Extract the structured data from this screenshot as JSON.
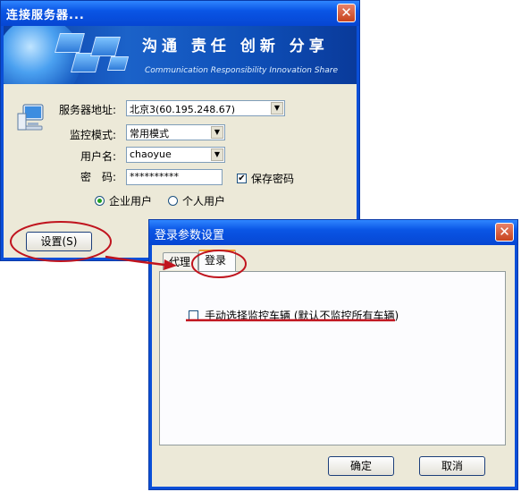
{
  "connect_dialog": {
    "title": "连接服务器...",
    "close_glyph": "✕",
    "banner": {
      "slogan": "沟通 责任 创新 分享",
      "slogan_en": "Communication Responsibility Innovation Share"
    },
    "server_label": "服务器地址:",
    "server_value": "北京3(60.195.248.67)",
    "mode_label": "监控模式:",
    "mode_value": "常用模式",
    "username_label": "用户名:",
    "username_value": "chaoyue",
    "password_label": "密　码:",
    "password_value": "**********",
    "save_password_label": "保存密码",
    "save_password_checked": true,
    "radio_enterprise": "企业用户",
    "radio_personal": "个人用户",
    "settings_button": "设置(S)"
  },
  "login_settings_dialog": {
    "title": "登录参数设置",
    "close_glyph": "✕",
    "tabs": [
      {
        "label": "代理",
        "active": false
      },
      {
        "label": "登录",
        "active": true
      }
    ],
    "manual_select_label": "手动选择监控车辆 (默认不监控所有车辆)",
    "manual_select_checked": false,
    "ok_button": "确定",
    "cancel_button": "取消"
  },
  "colors": {
    "title_bar": "#0a55e5",
    "dialog_bg": "#ece9d8",
    "annotation": "#c0141e"
  }
}
